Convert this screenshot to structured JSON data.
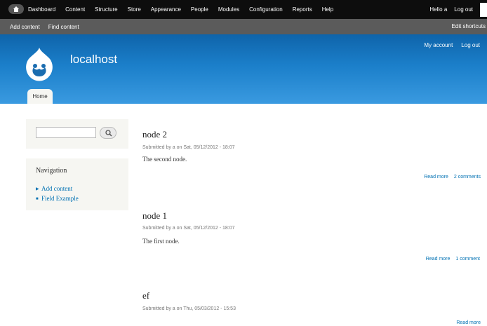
{
  "toolbar": {
    "menu": [
      "Dashboard",
      "Content",
      "Structure",
      "Store",
      "Appearance",
      "People",
      "Modules",
      "Configuration",
      "Reports",
      "Help"
    ],
    "hello": "Hello a",
    "logout": "Log out",
    "shortcuts": [
      "Add content",
      "Find content"
    ],
    "edit_shortcuts": "Edit shortcuts"
  },
  "header": {
    "site_name": "localhost",
    "secondary_menu": [
      "My account",
      "Log out"
    ],
    "main_tab": "Home"
  },
  "sidebar": {
    "search_placeholder": "",
    "navigation_title": "Navigation",
    "navigation_items": [
      "Add content",
      "Field Example"
    ]
  },
  "nodes": [
    {
      "title": "node 2",
      "submitted": "Submitted by a on Sat, 05/12/2012 - 18:07",
      "body": "The second node.",
      "links": [
        "Read more",
        "2 comments"
      ]
    },
    {
      "title": "node 1",
      "submitted": "Submitted by a on Sat, 05/12/2012 - 18:07",
      "body": "The first node.",
      "links": [
        "Read more",
        "1 comment"
      ]
    },
    {
      "title": "ef",
      "submitted": "Submitted by a on Thu, 05/03/2012 - 15:53",
      "body": "",
      "links": [
        "Read more"
      ]
    }
  ],
  "colors": {
    "toolbar": "#0d0d0d",
    "shortcut_bar": "#5b5b5b",
    "header_top": "#0f64aa",
    "header_bottom": "#3a9ae0",
    "link": "#0071b3",
    "sidebar_bg": "#f6f6f2"
  }
}
